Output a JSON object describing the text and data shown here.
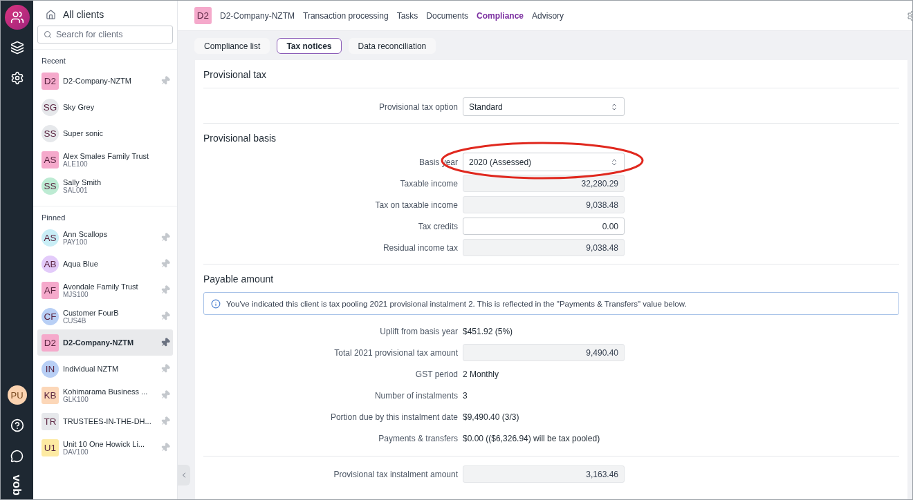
{
  "rail": {
    "user_initials": "PU",
    "logo": "vob"
  },
  "sidebar": {
    "title": "All clients",
    "search": {
      "placeholder": "Search for clients"
    },
    "sections": [
      {
        "title": "Recent",
        "clients": [
          {
            "initials": "D2",
            "name": "D2-Company-NZTM",
            "kind": "square",
            "color": "#f5a9cb",
            "pin": true,
            "selected": false
          },
          {
            "initials": "SG",
            "name": "Sky Grey",
            "kind": "circle",
            "color": "#e6e8eb",
            "pin": false,
            "selected": false
          },
          {
            "initials": "SS",
            "name": "Super sonic",
            "kind": "circle",
            "color": "#e6e8eb",
            "pin": false,
            "selected": false
          },
          {
            "initials": "AS",
            "name": "Alex Smales Family Trust",
            "code": "ALE100",
            "kind": "square",
            "color": "#f5a9cb",
            "pin": false,
            "selected": false
          },
          {
            "initials": "SS",
            "name": "Sally Smith",
            "code": "SAL001",
            "kind": "circle",
            "color": "#bdebd3",
            "pin": false,
            "selected": false
          }
        ]
      },
      {
        "title": "Pinned",
        "clients": [
          {
            "initials": "AS",
            "name": "Ann Scallops",
            "code": "PAY100",
            "kind": "circle",
            "color": "#c9eef6",
            "pin": true,
            "selected": false
          },
          {
            "initials": "AB",
            "name": "Aqua Blue",
            "kind": "circle",
            "color": "#e3cbfa",
            "pin": true,
            "selected": false
          },
          {
            "initials": "AF",
            "name": "Avondale Family Trust",
            "code": "MJS100",
            "kind": "square",
            "color": "#f5a9cb",
            "pin": true,
            "selected": false
          },
          {
            "initials": "CF",
            "name": "Customer FourB",
            "code": "CUS4B",
            "kind": "circle",
            "color": "#b8cff5",
            "pin": true,
            "selected": false
          },
          {
            "initials": "D2",
            "name": "D2-Company-NZTM",
            "kind": "square",
            "color": "#f5a9cb",
            "pin": true,
            "selected": true
          },
          {
            "initials": "IN",
            "name": "Individual NZTM",
            "kind": "circle",
            "color": "#b8cff5",
            "pin": true,
            "selected": false
          },
          {
            "initials": "KB",
            "name": "Kohimarama Business ...",
            "code": "GLK100",
            "kind": "square",
            "color": "#fcd7b8",
            "pin": true,
            "selected": false
          },
          {
            "initials": "TR",
            "name": "TRUSTEES-IN-THE-DH...",
            "kind": "square",
            "color": "#e6e8eb",
            "pin": true,
            "selected": false
          },
          {
            "initials": "U1",
            "name": "Unit 10 One Howick Li...",
            "code": "DAV100",
            "kind": "square",
            "color": "#fdeaa2",
            "pin": true,
            "selected": false
          }
        ]
      }
    ]
  },
  "header": {
    "client_initials": "D2",
    "client_name": "D2-Company-NZTM",
    "nav": [
      {
        "label": "Transaction processing",
        "selected": false
      },
      {
        "label": "Tasks",
        "selected": false
      },
      {
        "label": "Documents",
        "selected": false
      },
      {
        "label": "Compliance",
        "selected": true
      },
      {
        "label": "Advisory",
        "selected": false
      }
    ]
  },
  "subtabs": [
    {
      "label": "Compliance list",
      "selected": false
    },
    {
      "label": "Tax notices",
      "selected": true
    },
    {
      "label": "Data reconciliation",
      "selected": false
    }
  ],
  "sections": [
    {
      "title": "Provisional tax",
      "rows": [
        {
          "kind": "select",
          "label": "Provisional tax option",
          "value": "Standard"
        }
      ]
    },
    {
      "title": "Provisional basis",
      "rows": [
        {
          "kind": "select",
          "label": "Basis year",
          "value": "2020 (Assessed)",
          "highlighted": true
        },
        {
          "kind": "readonly",
          "label": "Taxable income",
          "value": "32,280.29"
        },
        {
          "kind": "readonly",
          "label": "Tax on taxable income",
          "value": "9,038.48"
        },
        {
          "kind": "input",
          "label": "Tax credits",
          "value": "0.00"
        },
        {
          "kind": "readonly",
          "label": "Residual income tax",
          "value": "9,038.48"
        }
      ]
    },
    {
      "title": "Payable amount",
      "info": "You've indicated this client is tax pooling 2021 provisional instalment 2. This is reflected in the \"Payments & Transfers\" value below.",
      "rows": [
        {
          "kind": "text",
          "label": "Uplift from basis year",
          "value": "$451.92 (5%)"
        },
        {
          "kind": "readonly",
          "label": "Total 2021 provisional tax amount",
          "value": "9,490.40"
        },
        {
          "kind": "text",
          "label": "GST period",
          "value": "2 Monthly"
        },
        {
          "kind": "text",
          "label": "Number of instalments",
          "value": "3"
        },
        {
          "kind": "text",
          "label": "Portion due by this instalment date",
          "value": "$9,490.40 (3/3)"
        },
        {
          "kind": "text",
          "label": "Payments & transfers",
          "value": "$0.00 (($6,326.94) will be tax pooled)"
        },
        {
          "kind": "divider"
        },
        {
          "kind": "readonly",
          "label": "Provisional tax instalment amount",
          "value": "3,163.46"
        }
      ]
    }
  ]
}
